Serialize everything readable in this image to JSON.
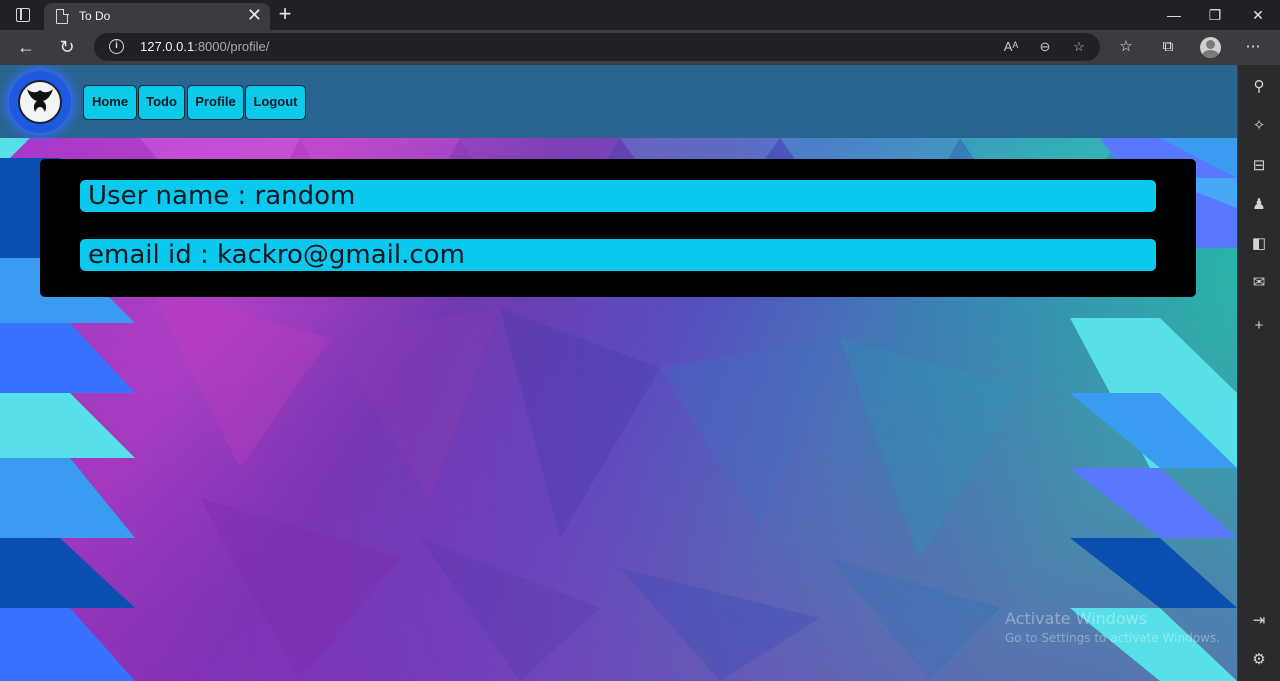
{
  "browser": {
    "tab_title": "To Do",
    "tab_close": "✕",
    "new_tab": "+",
    "url_host": "127.0.0.1",
    "url_rest": ":8000/profile/",
    "window": {
      "minimize": "—",
      "restore": "❐",
      "close": "✕"
    }
  },
  "navbar": {
    "links": [
      {
        "label": "Home"
      },
      {
        "label": "Todo"
      },
      {
        "label": "Profile"
      },
      {
        "label": "Logout"
      }
    ]
  },
  "profile": {
    "username_line": "User name : random",
    "email_line": "email id : kackro@gmail.com"
  },
  "watermark": {
    "line1": "Activate Windows",
    "line2": "Go to Settings to activate Windows."
  },
  "colors": {
    "navbar": "#2a6590",
    "button": "#0ccaea",
    "field": "#0bc8ee",
    "card": "#000000"
  }
}
